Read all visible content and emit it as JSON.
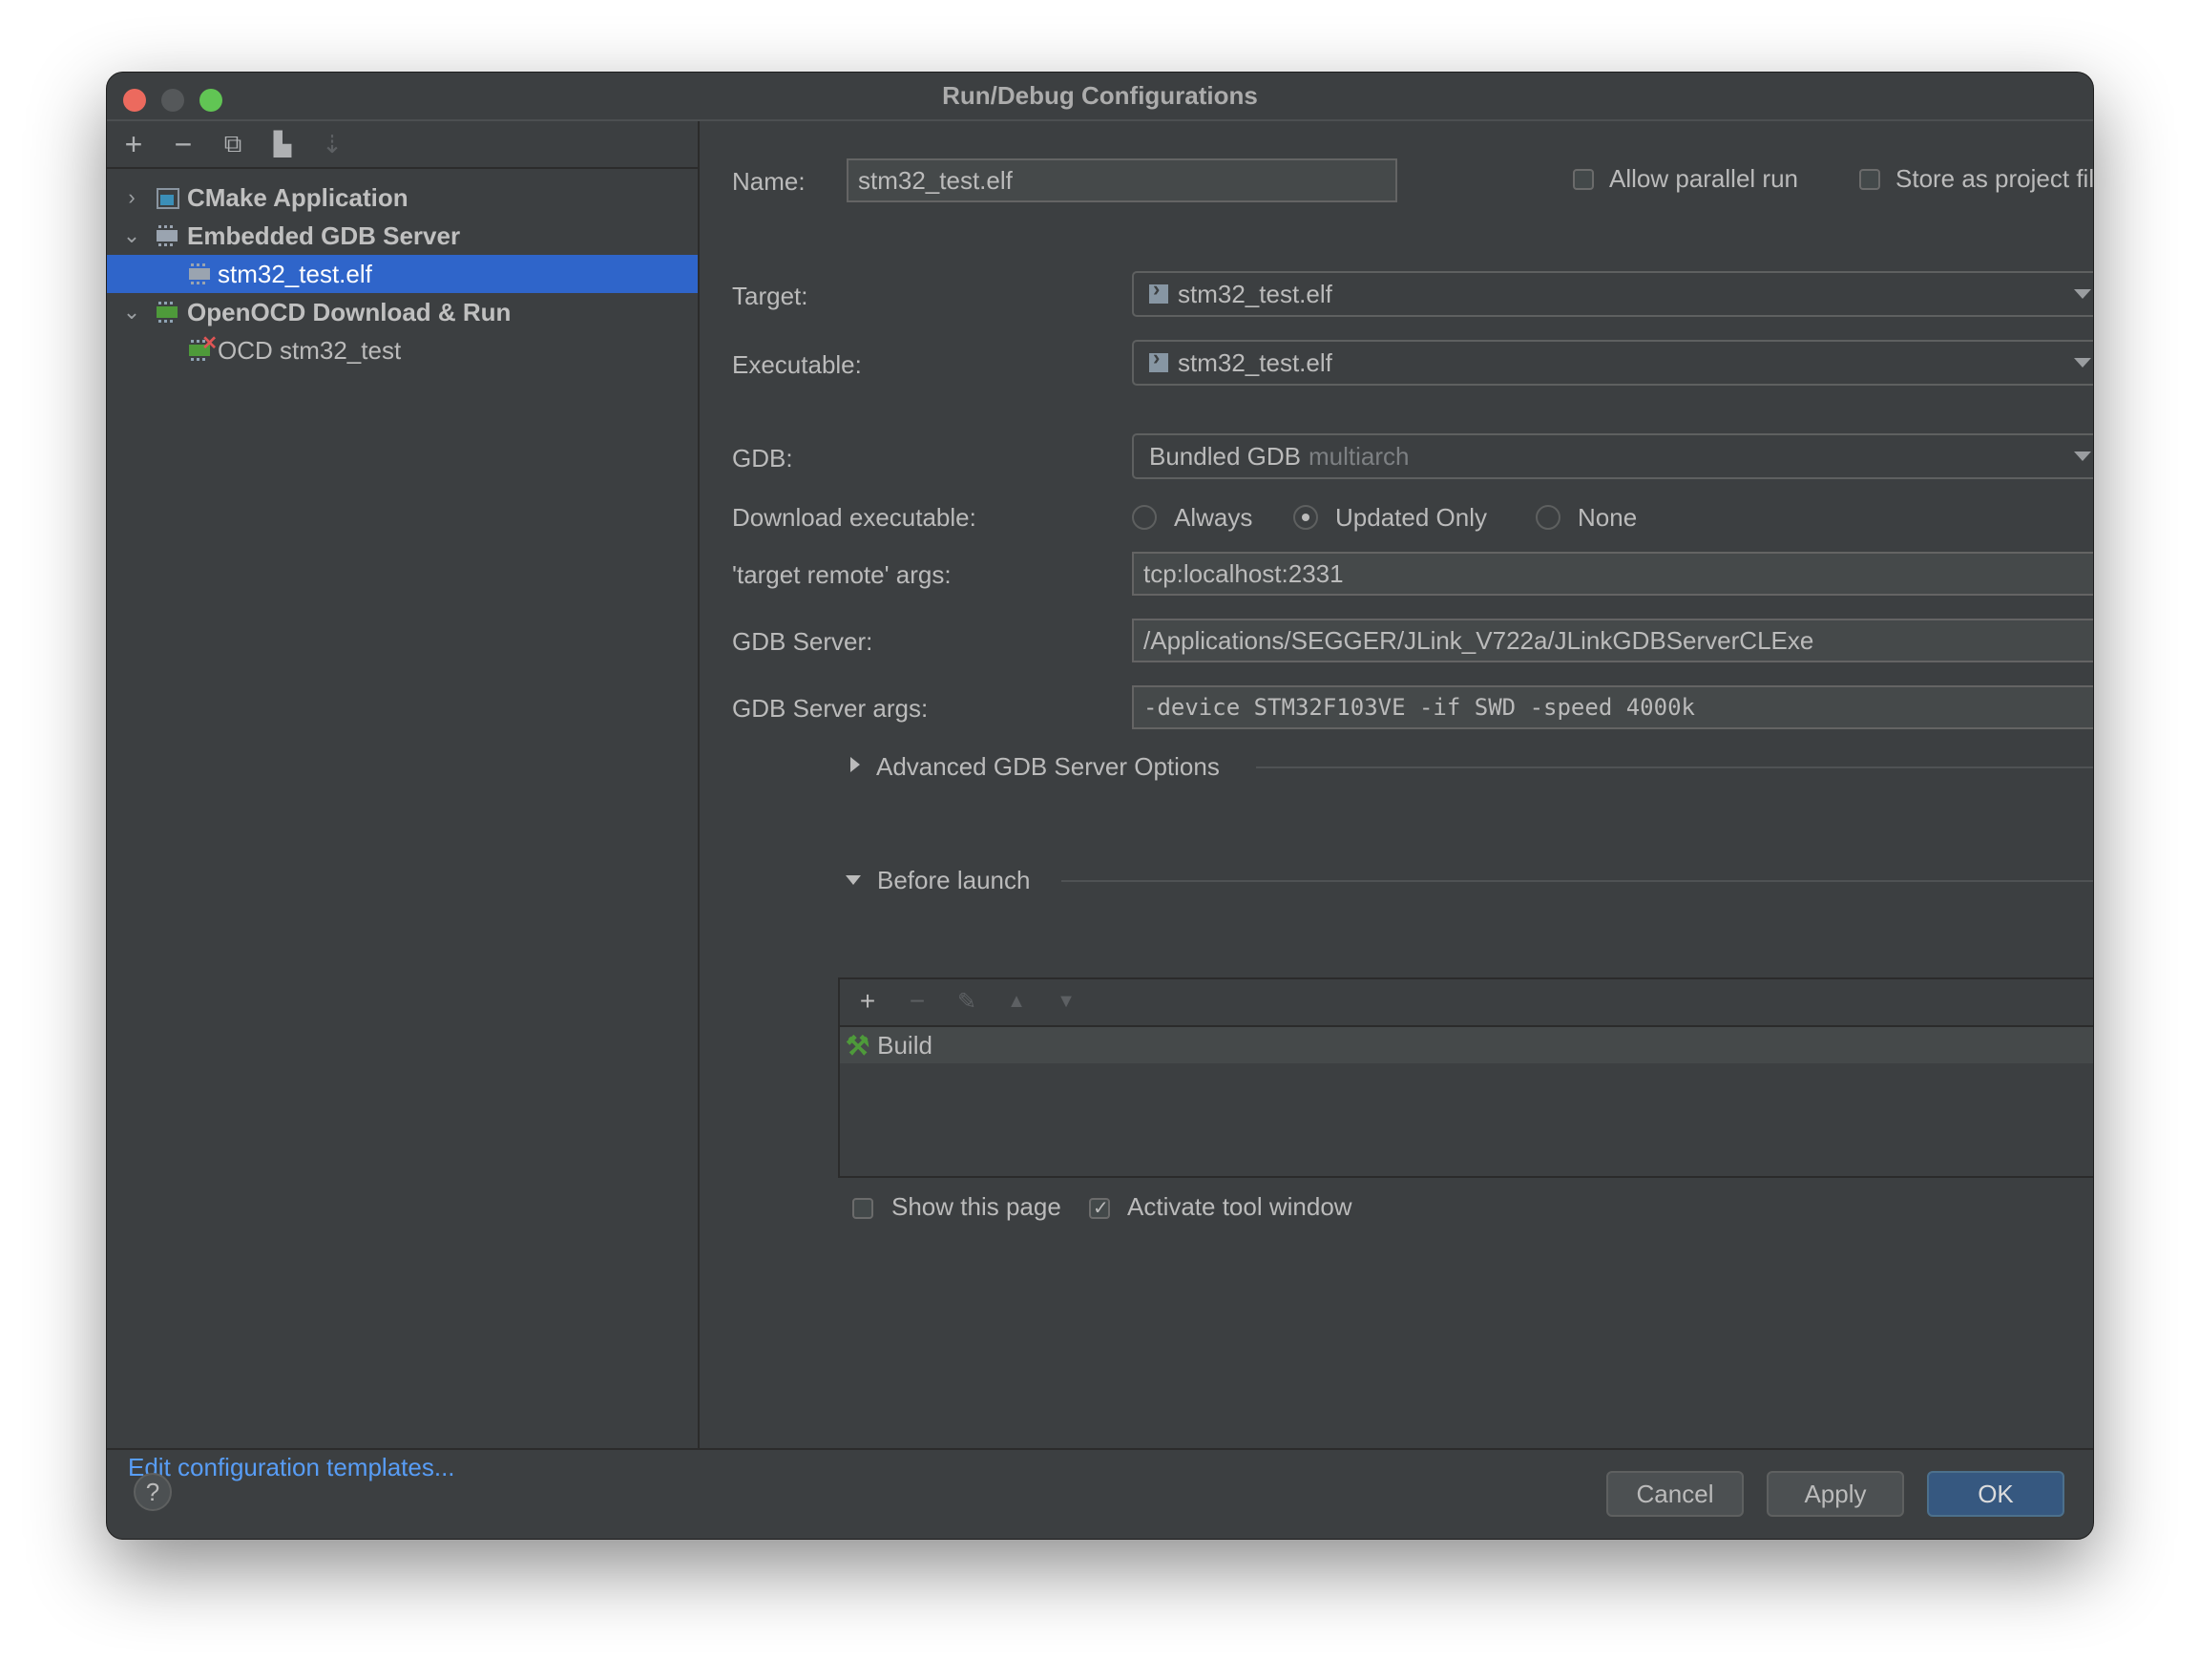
{
  "window": {
    "title": "Run/Debug Configurations"
  },
  "sidebar": {
    "toolbar": [
      {
        "name": "add",
        "icon": "plus-icon",
        "glyph": "+"
      },
      {
        "name": "remove",
        "icon": "minus-icon",
        "glyph": "−"
      },
      {
        "name": "copy",
        "icon": "copy-icon",
        "glyph": "⧉"
      },
      {
        "name": "new-folder",
        "icon": "folder-add-icon",
        "glyph": "▙"
      },
      {
        "name": "sort",
        "icon": "sort-alpha-icon",
        "glyph": "⇣"
      }
    ],
    "tree": [
      {
        "label": "CMake Application",
        "type": "group",
        "expanded": false,
        "chevron": "›"
      },
      {
        "label": "Embedded GDB Server",
        "type": "group",
        "expanded": true,
        "chevron": "⌄"
      },
      {
        "label": "stm32_test.elf",
        "type": "item",
        "selected": true
      },
      {
        "label": "OpenOCD Download & Run",
        "type": "group",
        "expanded": true,
        "chevron": "⌄"
      },
      {
        "label": "OCD stm32_test",
        "type": "item",
        "error": true
      }
    ],
    "edit_templates_link": "Edit configuration templates..."
  },
  "form": {
    "name_label": "Name:",
    "name_value": "stm32_test.elf",
    "allow_parallel_label": "Allow parallel run",
    "allow_parallel_checked": false,
    "store_project_label": "Store as project file",
    "store_project_checked": false,
    "target_label": "Target:",
    "target_value": "stm32_test.elf",
    "executable_label": "Executable:",
    "executable_value": "stm32_test.elf",
    "gdb_label": "GDB:",
    "gdb_value": "Bundled GDB",
    "gdb_value_hint": "multiarch",
    "download_label": "Download executable:",
    "download_options": [
      "Always",
      "Updated Only",
      "None"
    ],
    "download_selected": "Updated Only",
    "target_remote_label": "'target remote' args:",
    "target_remote_value": "tcp:localhost:2331",
    "gdb_server_label": "GDB Server:",
    "gdb_server_value": "/Applications/SEGGER/JLink_V722a/JLinkGDBServerCLExe",
    "gdb_server_args_label": "GDB Server args:",
    "gdb_server_args_value": "-device STM32F103VE -if SWD -speed 4000k",
    "browse_button": "...",
    "advanced_label": "Advanced GDB Server Options",
    "before_launch_label": "Before launch",
    "before_launch_items": [
      "Build"
    ],
    "show_page_label": "Show this page",
    "show_page_checked": false,
    "activate_tool_label": "Activate tool window",
    "activate_tool_checked": true
  },
  "footer": {
    "help": "?",
    "cancel": "Cancel",
    "apply": "Apply",
    "ok": "OK"
  },
  "colors": {
    "background": "#3c3f41",
    "selection": "#2f65ca",
    "link": "#589df6",
    "primary_button": "#365880",
    "build_icon": "#4e9a3a"
  }
}
